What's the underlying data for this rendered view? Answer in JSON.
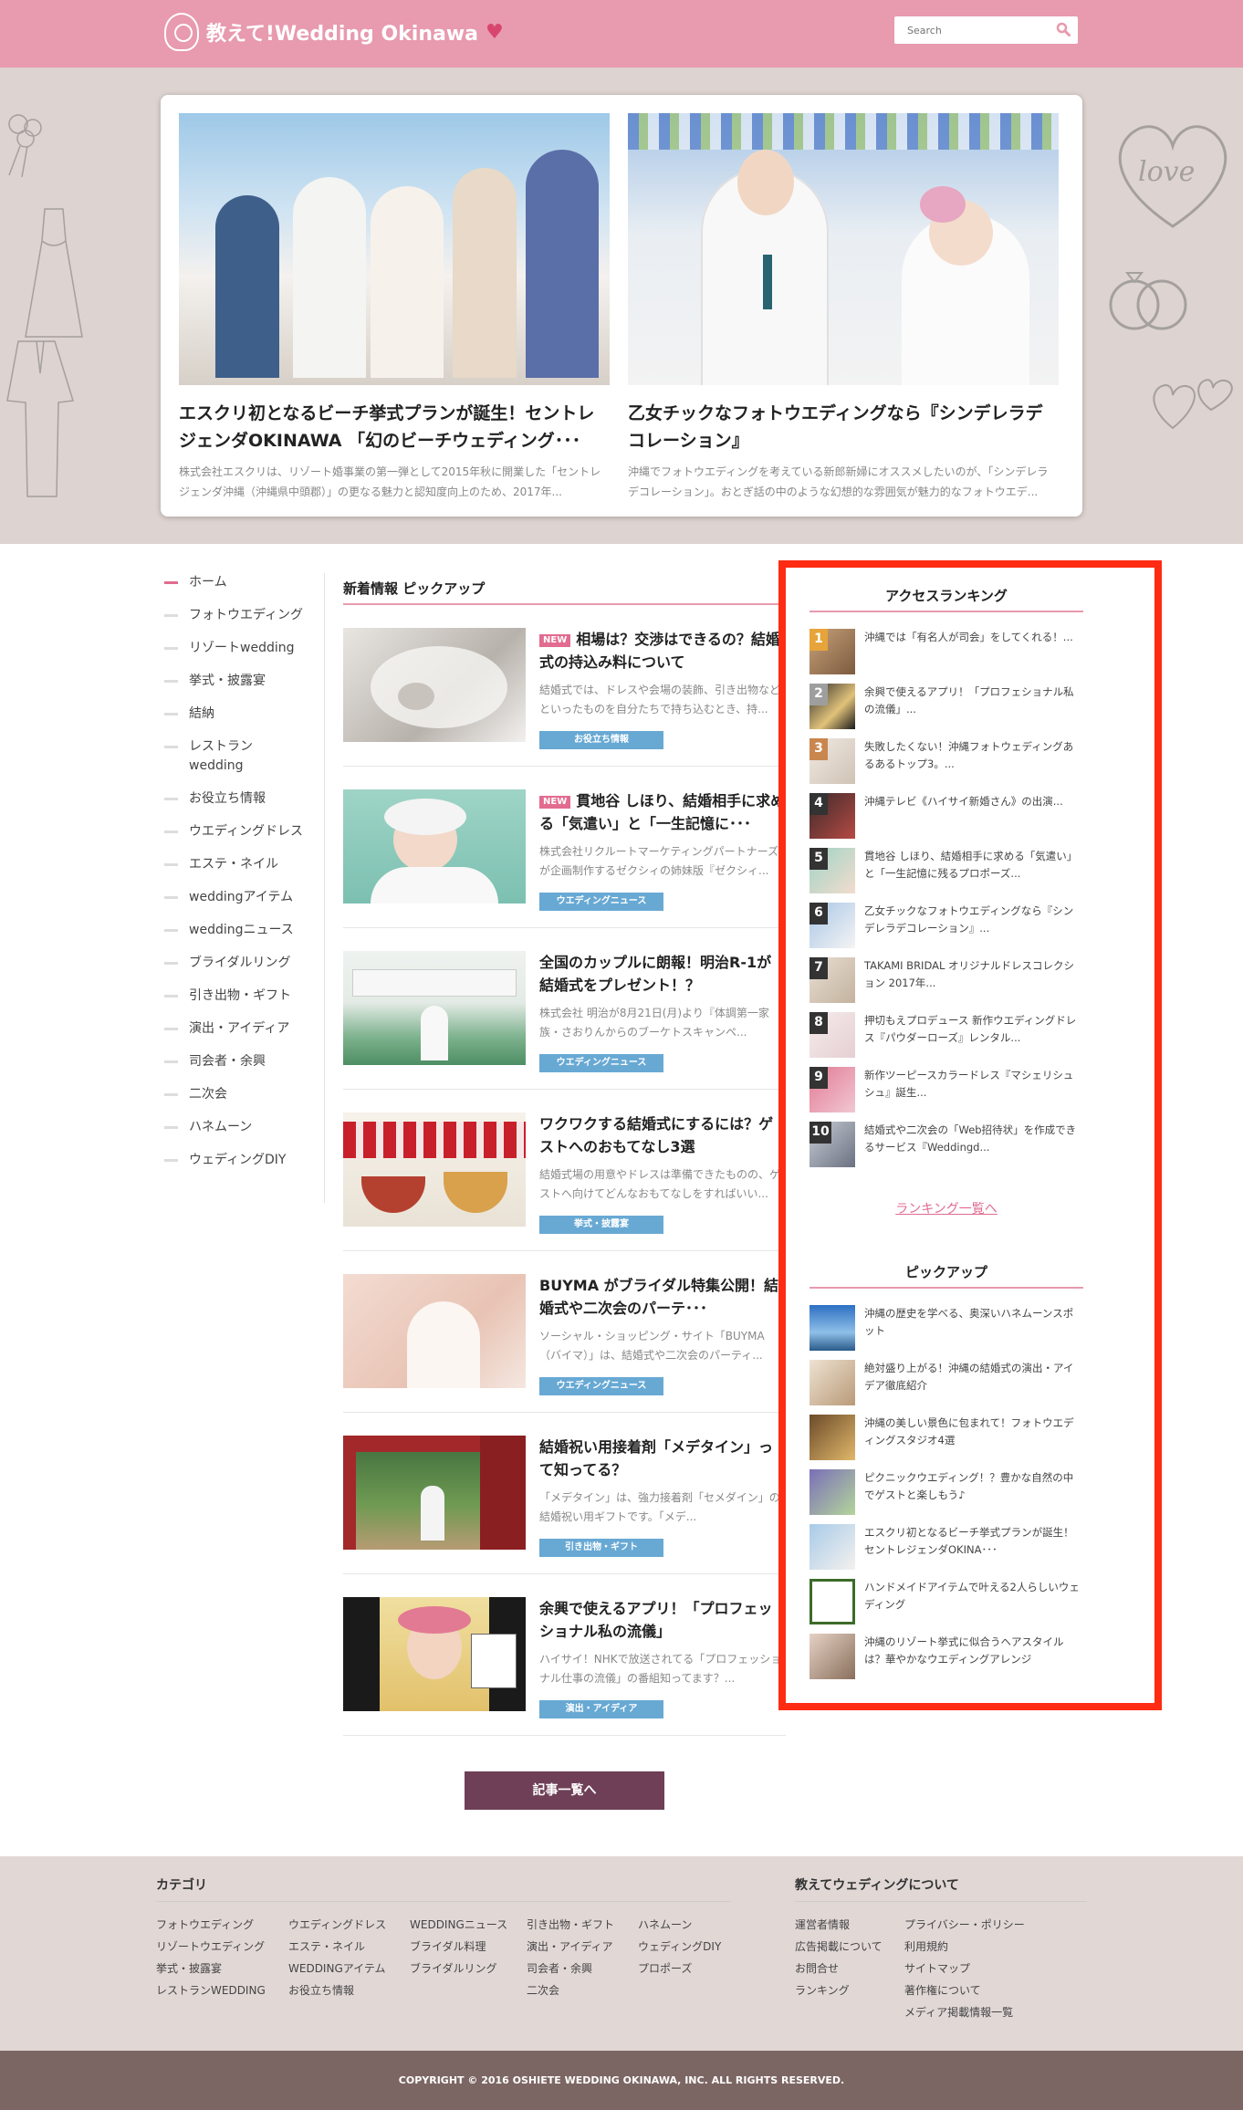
{
  "header": {
    "logo_text": "教えて!Wedding Okinawa",
    "search_placeholder": "Search"
  },
  "hero": {
    "items": [
      {
        "title": "エスクリ初となるビーチ挙式プランが誕生！セントレジェンダOKINAWA 「幻のビーチウェディング･･･",
        "desc": "株式会社エスクリは、リゾート婚事業の第一弾として2015年秋に開業した「セントレジェンダ沖縄（沖縄県中頭郡）」の更なる魅力と認知度向上のため、2017年..."
      },
      {
        "title": "乙女チックなフォトウエディングなら『シンデレラデコレーション』",
        "desc": "沖縄でフォトウエディングを考えている新郎新婦にオススメしたいのが、「シンデレラデコレーション」。おとぎ話の中のような幻想的な雰囲気が魅力的なフォトウエデ..."
      }
    ]
  },
  "nav": {
    "items": [
      "ホーム",
      "フォトウエディング",
      "リゾートwedding",
      "挙式・披露宴",
      "結納",
      "レストラン wedding",
      "お役立ち情報",
      "ウエディングドレス",
      "エステ・ネイル",
      "weddingアイテム",
      "weddingニュース",
      "ブライダルリング",
      "引き出物・ギフト",
      "演出・アイディア",
      "司会者・余興",
      "二次会",
      "ハネムーン",
      "ウェディングDIY"
    ]
  },
  "main": {
    "section_title": "新着情報 ピックアップ",
    "new_label": "NEW",
    "articles": [
      {
        "title": "相場は？交渉はできるの？結婚式の持込み料について",
        "desc": "結婚式では、ドレスや会場の装飾、引き出物などといったものを自分たちで持ち込むとき、持...",
        "tag": "お役立ち情報"
      },
      {
        "title": "貫地谷 しほり、結婚相手に求める「気遣い」と「一生記憶に･･･",
        "desc": "株式会社リクルートマーケティングパートナーズが企画制作するゼクシィの姉妹版『ゼクシィ...",
        "tag": "ウエディングニュース"
      },
      {
        "title": "全国のカップルに朗報！明治R-1が結婚式をプレゼント！？",
        "desc": "株式会社 明治が8月21日(月)より『体調第一家族・さおりんからのブーケトスキャンペ...",
        "tag": "ウエディングニュース"
      },
      {
        "title": "ワクワクする結婚式にするには？ゲストへのおもてなし3選",
        "desc": "結婚式場の用意やドレスは準備できたものの、ゲストへ向けてどんなおもてなしをすればいい...",
        "tag": "挙式・披露宴"
      },
      {
        "title": "BUYMA がブライダル特集公開！結婚式や二次会のパーテ･･･",
        "desc": "ソーシャル・ショッピング・サイト「BUYMA（バイマ）」は、結婚式や二次会のパーティ...",
        "tag": "ウエディングニュース"
      },
      {
        "title": "結婚祝い用接着剤「メデタイン」って知ってる？",
        "desc": "「メデタイン」は、強力接着剤「セメダイン」の結婚祝い用ギフトです。「メデ...",
        "tag": "引き出物・ギフト"
      },
      {
        "title": "余興で使えるアプリ！「プロフェッショナル私の流儀」",
        "desc": "ハイサイ！NHKで放送されてる「プロフェッショナル仕事の流儀」の番組知ってます？...",
        "tag": "演出・アイディア"
      }
    ],
    "more_button": "記事一覧へ"
  },
  "sidebar": {
    "ranking_title": "アクセスランキング",
    "ranking": [
      {
        "num": "1",
        "text": "沖縄では「有名人が司会」をしてくれる！..."
      },
      {
        "num": "2",
        "text": "余興で使えるアプリ！「プロフェショナル私の流儀」..."
      },
      {
        "num": "3",
        "text": "失敗したくない！沖縄フォトウェディングあるあるトップ3。..."
      },
      {
        "num": "4",
        "text": "沖縄テレビ《ハイサイ新婚さん》の出演..."
      },
      {
        "num": "5",
        "text": "貫地谷 しほり、結婚相手に求める「気遣い」と「一生記憶に残るプロポーズ..."
      },
      {
        "num": "6",
        "text": "乙女チックなフォトウエディングなら『シンデレラデコレーション』..."
      },
      {
        "num": "7",
        "text": "TAKAMI BRIDAL オリジナルドレスコレクション 2017年..."
      },
      {
        "num": "8",
        "text": "押切もえプロデュース 新作ウエディングドレス『パウダーローズ』レンタル..."
      },
      {
        "num": "9",
        "text": "新作ツーピースカラードレス『マシェリシュシュ』誕生..."
      },
      {
        "num": "10",
        "text": "結婚式や二次会の「Web招待状」を作成できるサービス『Weddingd..."
      }
    ],
    "ranking_more": "ランキング一覧へ",
    "pickup_title": "ピックアップ",
    "pickup": [
      "沖縄の歴史を学べる、奥深いハネムーンスポット",
      "絶対盛り上がる！沖縄の結婚式の演出・アイデア徹底紹介",
      "沖縄の美しい景色に包まれて！フォトウエディングスタジオ4選",
      "ピクニックウエディング！？豊かな自然の中でゲストと楽しもう♪",
      "エスクリ初となるビーチ挙式プランが誕生！セントレジェンダOKINA･･･",
      "ハンドメイドアイテムで叶える2人らしいウェディング",
      "沖縄のリゾート挙式に似合うヘアスタイルは？華やかなウエディングアレンジ"
    ]
  },
  "footer": {
    "category_title": "カテゴリ",
    "about_title": "教えてウェディングについて",
    "cat_cols": [
      [
        "フォトウエディング",
        "リゾートウエディング",
        "挙式・披露宴",
        "レストランWEDDING"
      ],
      [
        "ウエディングドレス",
        "エステ・ネイル",
        "WEDDINGアイテム",
        "お役立ち情報"
      ],
      [
        "WEDDINGニュース",
        "ブライダル料理",
        "ブライダルリング"
      ],
      [
        "引き出物・ギフト",
        "演出・アイディア",
        "司会者・余興",
        "二次会"
      ],
      [
        "ハネムーン",
        "ウェディングDIY",
        "プロポーズ"
      ]
    ],
    "about_cols": [
      [
        "運営者情報",
        "広告掲載について",
        "お問合せ",
        "ランキング"
      ],
      [
        "プライバシー・ポリシー",
        "利用規約",
        "サイトマップ",
        "著作権について",
        "メディア掲載情報一覧"
      ]
    ],
    "copyright": "COPYRIGHT © 2016 OSHIETE WEDDING OKINAWA, INC. ALL RIGHTS RESERVED."
  },
  "colors": {
    "header_pink": "#e89aae",
    "accent_pink": "#e26b90",
    "tag_blue": "#68a9d4",
    "button_plum": "#6e3f56",
    "highlight_red": "#ff2b12",
    "footer_bg": "#e1d8d6",
    "copyright_bg": "#7c6663"
  }
}
